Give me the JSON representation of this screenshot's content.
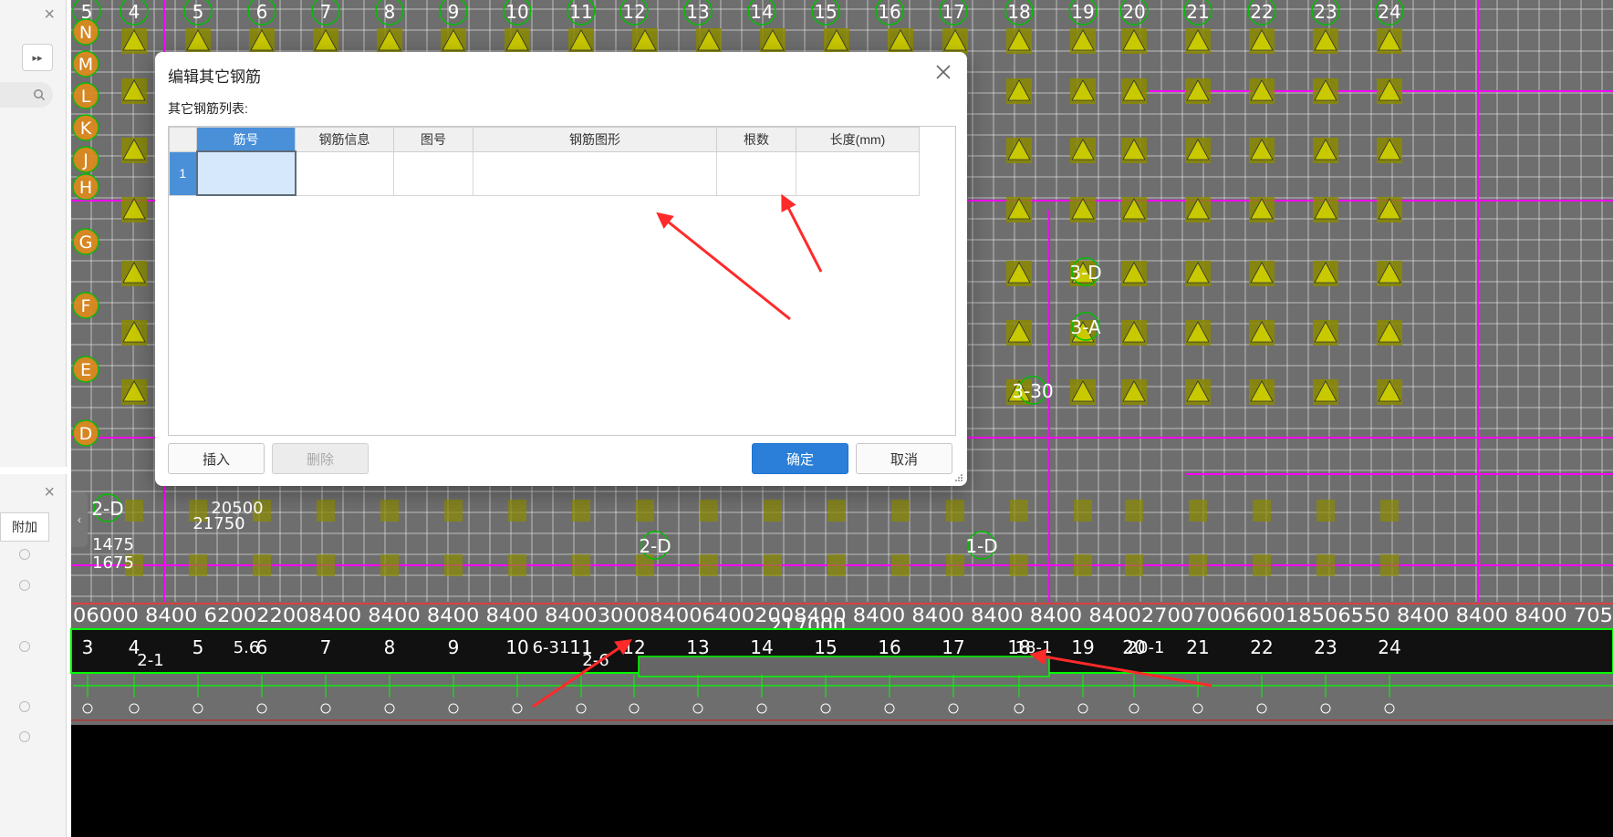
{
  "dialog": {
    "title": "编辑其它钢筋",
    "list_label": "其它钢筋列表:",
    "columns": [
      "筋号",
      "钢筋信息",
      "图号",
      "钢筋图形",
      "根数",
      "长度(mm)"
    ],
    "rows": [
      {
        "row_number": "1",
        "cells": [
          "",
          "",
          "",
          "",
          "",
          ""
        ]
      }
    ],
    "buttons": {
      "insert": "插入",
      "delete": "删除",
      "ok": "确定",
      "cancel": "取消"
    }
  },
  "left_panel": {
    "tab_label": "附加"
  },
  "cad": {
    "top_axis_labels": [
      "5",
      "4",
      "5",
      "6",
      "7",
      "8",
      "9",
      "10",
      "11",
      "12",
      "13",
      "14",
      "15",
      "16",
      "17",
      "18",
      "19",
      "20",
      "21",
      "22",
      "23",
      "24"
    ],
    "row_axis_labels": [
      "N",
      "M",
      "L",
      "K",
      "J",
      "H",
      "G",
      "F",
      "E",
      "D"
    ],
    "right_axis_labels": [
      "3-D",
      "3-A",
      "3-30"
    ],
    "mid_axis_labels": [
      "2-D",
      "2-D",
      "1-D"
    ],
    "bottom_axis_labels": [
      "3",
      "4",
      "5",
      "6",
      "7",
      "8",
      "9",
      "10",
      "11",
      "12",
      "13",
      "14",
      "15",
      "16",
      "17",
      "18",
      "19",
      "20",
      "21",
      "22",
      "23",
      "24"
    ],
    "dimension_text": "06000 8400 620022008400 8400 8400 8400 84003000840064002008400 8400 8400 8400 8400 84002700700660018506550 8400 8400 8400 705",
    "total_dimension": "217000",
    "misc_labels": [
      "2-1",
      "2-6",
      "1475",
      "1675",
      "20500",
      "21750",
      "5.6",
      "6-31",
      "18-1",
      "20-1"
    ],
    "colors": {
      "background": "#6e6e6e",
      "grid": "#ffffff",
      "beam": "#ff00ff",
      "axis_circle": "#00c000",
      "column": "#8a8a00",
      "dimension": "#00ff00",
      "arrow": "#ff2a2a"
    }
  }
}
